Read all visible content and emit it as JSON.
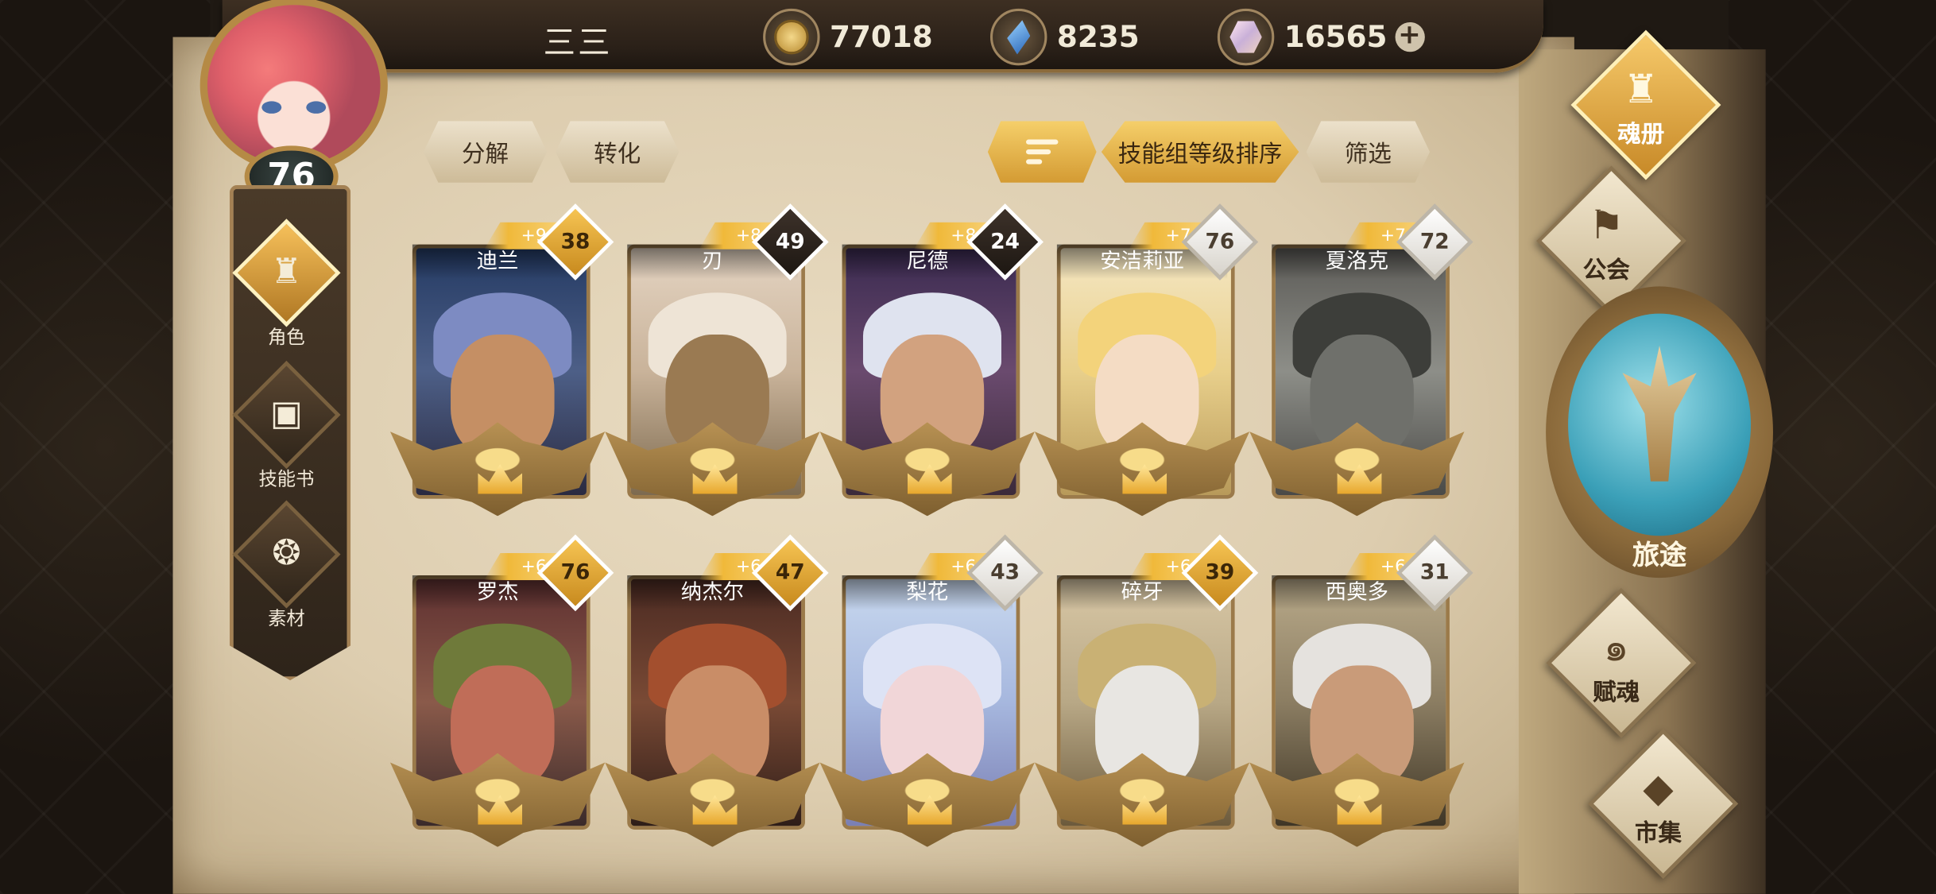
{
  "header": {
    "player_name": "三三",
    "player_level": "76",
    "resources": [
      {
        "icon": "gold-coin-icon",
        "value": "77018"
      },
      {
        "icon": "blue-crystal-icon",
        "value": "8235"
      },
      {
        "icon": "rainbow-gem-icon",
        "value": "16565"
      }
    ],
    "add_label": "+"
  },
  "left_nav": [
    {
      "label": "角色",
      "icon": "helmet-icon",
      "active": true
    },
    {
      "label": "技能书",
      "icon": "book-icon",
      "active": false
    },
    {
      "label": "素材",
      "icon": "material-icon",
      "active": false
    }
  ],
  "toolbar": {
    "decompose": "分解",
    "convert": "转化",
    "sort_icon": "sort-order-icon",
    "sort_by": "技能组等级排序",
    "filter": "筛选"
  },
  "heroes": [
    {
      "name": "迪兰",
      "plus": "+9",
      "level": "38",
      "badge": "gold"
    },
    {
      "name": "刃",
      "plus": "+8",
      "level": "49",
      "badge": "dark"
    },
    {
      "name": "尼德",
      "plus": "+8",
      "level": "24",
      "badge": "dark"
    },
    {
      "name": "安洁莉亚",
      "plus": "+7",
      "level": "76",
      "badge": "white"
    },
    {
      "name": "夏洛克",
      "plus": "+7",
      "level": "72",
      "badge": "white"
    },
    {
      "name": "罗杰",
      "plus": "+6",
      "level": "76",
      "badge": "gold"
    },
    {
      "name": "纳杰尔",
      "plus": "+6",
      "level": "47",
      "badge": "gold"
    },
    {
      "name": "梨花",
      "plus": "+6",
      "level": "43",
      "badge": "white"
    },
    {
      "name": "碎牙",
      "plus": "+6",
      "level": "39",
      "badge": "gold"
    },
    {
      "name": "西奥多",
      "plus": "+6",
      "level": "31",
      "badge": "white"
    }
  ],
  "right_menu": {
    "soul_book": "魂册",
    "guild": "公会",
    "journey": "旅途",
    "soul_grant": "赋魂",
    "market": "市集"
  },
  "colors": {
    "accent_gold": "#f0b93a",
    "parchment": "#e4d6ba",
    "journey_teal": "#3ba0b8"
  }
}
